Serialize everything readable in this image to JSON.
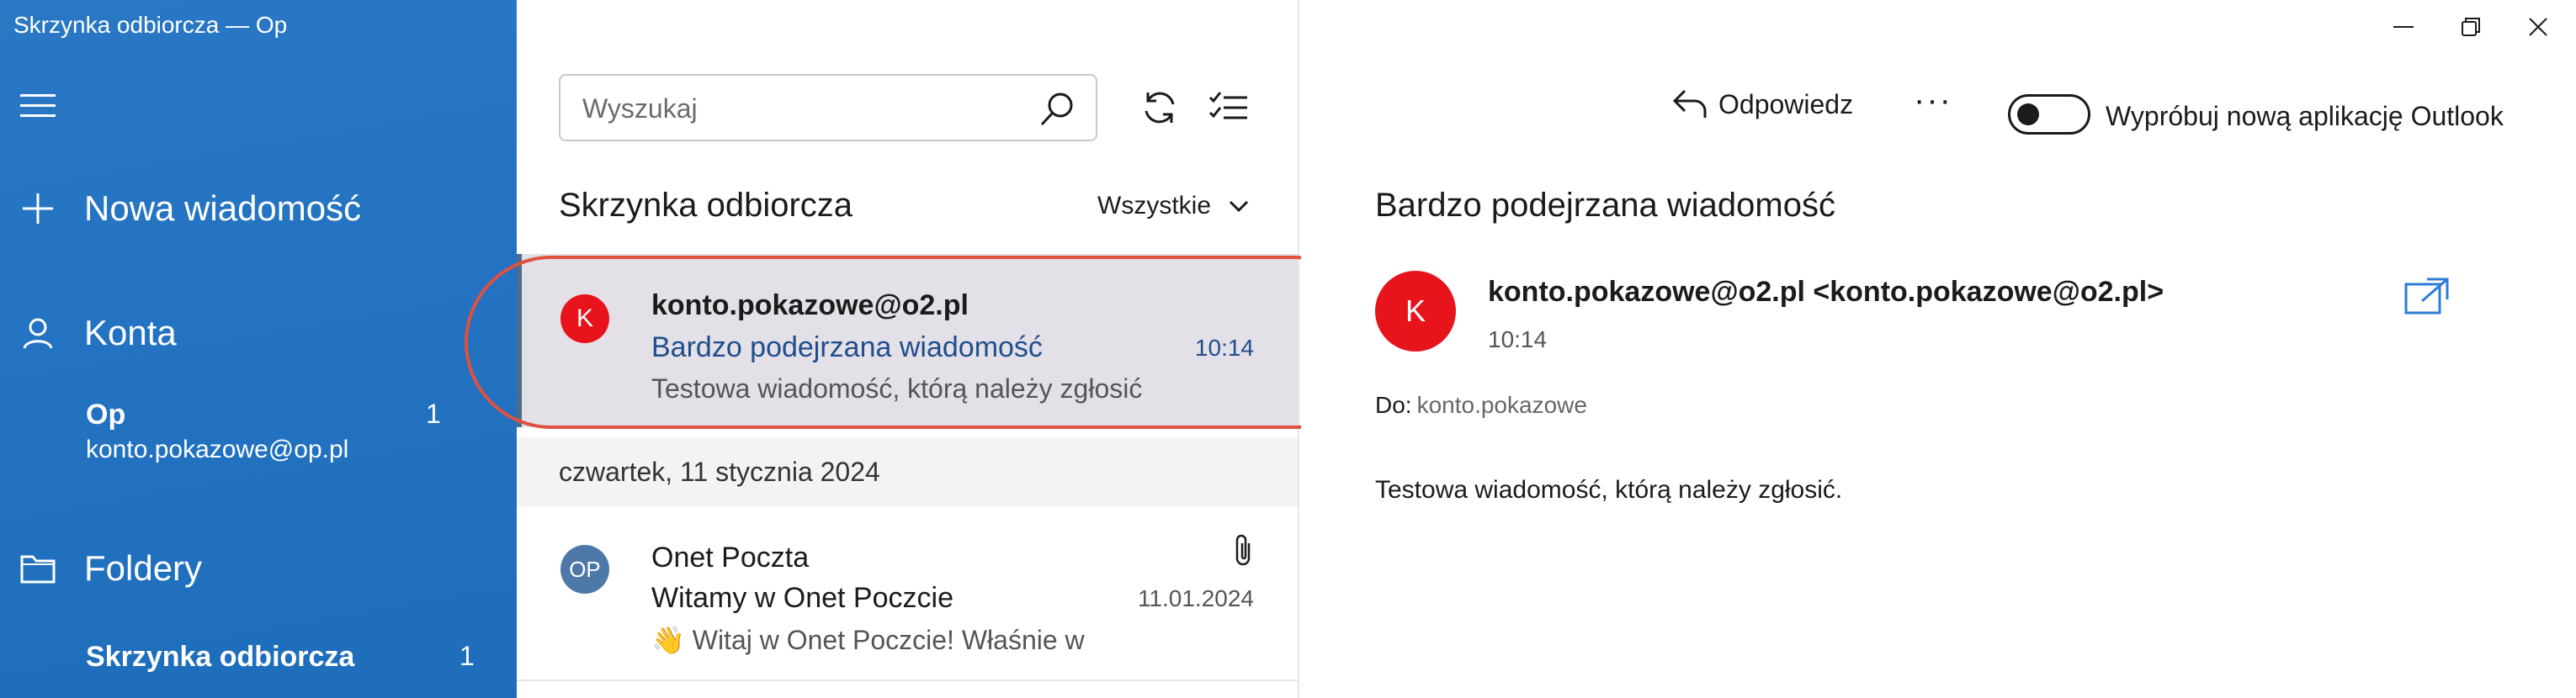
{
  "window": {
    "title": "Skrzynka odbiorcza — Op"
  },
  "sidebar": {
    "menu_icon": "hamburger-icon",
    "new_message": "Nowa wiadomość",
    "accounts_label": "Konta",
    "account": {
      "name": "Op",
      "email": "konto.pokazowe@op.pl",
      "count": "1"
    },
    "folders_label": "Foldery",
    "active_folder": {
      "name": "Skrzynka odbiorcza",
      "count": "1"
    },
    "colors": {
      "background": "#2373c2"
    }
  },
  "list": {
    "search": {
      "placeholder": "Wyszukaj",
      "value": ""
    },
    "title": "Skrzynka odbiorcza",
    "filter": "Wszystkie",
    "messages": [
      {
        "avatar": "K",
        "avatar_color": "#e8141c",
        "from": "konto.pokazowe@o2.pl",
        "subject": "Bardzo podejrzana wiadomość",
        "time": "10:14",
        "preview": "Testowa wiadomość, którą należy zgłosić",
        "selected": true
      }
    ],
    "date_separator": "czwartek, 11 stycznia 2024",
    "older": [
      {
        "avatar": "OP",
        "avatar_color": "#4d78a8",
        "from": "Onet Poczta",
        "subject": "Witamy w Onet Poczcie",
        "time": "11.01.2024",
        "preview": "👋 Witaj w Onet Poczcie! Właśnie w",
        "has_attachment": true
      }
    ]
  },
  "reader": {
    "reply": "Odpowiedz",
    "more": "···",
    "toggle_label": "Wypróbuj nową aplikację Outlook",
    "subject": "Bardzo podejrzana wiadomość",
    "avatar": "K",
    "sender": "konto.pokazowe@o2.pl <konto.pokazowe@o2.pl>",
    "time": "10:14",
    "to_label": "Do:",
    "to_value": "konto.pokazowe",
    "body": "Testowa wiadomość, którą należy zgłosić."
  },
  "colors": {
    "accent": "#2373c2",
    "unread_subject": "#1f4e8c",
    "highlight": "#e0513f"
  }
}
